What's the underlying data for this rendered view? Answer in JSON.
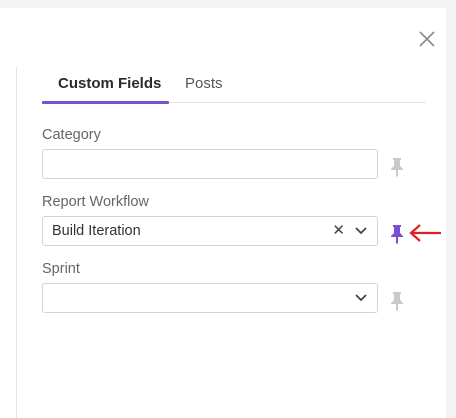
{
  "tabs": [
    {
      "label": "Custom Fields",
      "active": true
    },
    {
      "label": "Posts",
      "active": false
    }
  ],
  "fields": [
    {
      "label": "Category",
      "value": "",
      "placeholder": "",
      "pinned": false
    },
    {
      "label": "Report Workflow",
      "value": "Build Iteration",
      "pinned": true
    },
    {
      "label": "Sprint",
      "value": "",
      "pinned": false
    }
  ],
  "colors": {
    "accent": "#7b4fd1",
    "pin_inactive": "#c9c9c9",
    "annotation_arrow": "#e02020"
  },
  "icons": {
    "close": "close-icon",
    "clear": "clear-x-icon",
    "dropdown": "chevron-down-icon",
    "pin": "pin-icon",
    "annotation": "red-arrow-icon"
  }
}
